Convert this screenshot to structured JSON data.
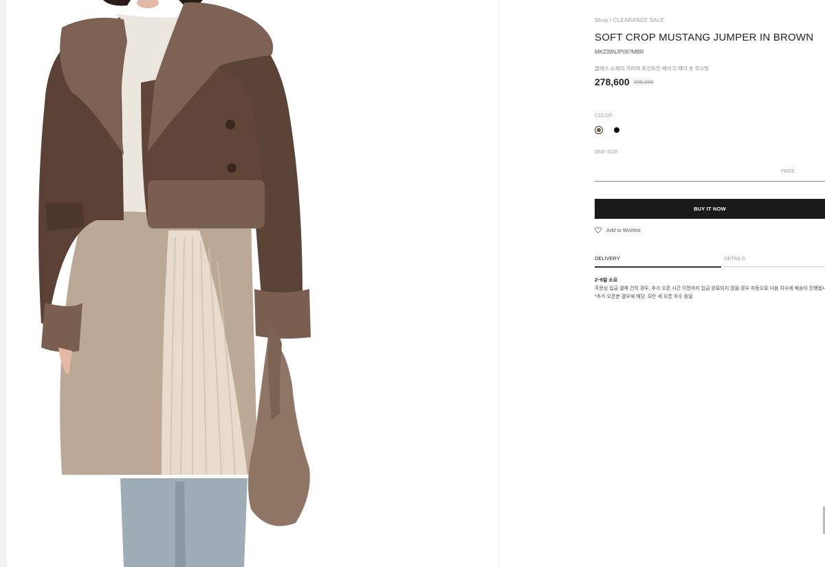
{
  "product": {
    "breadcrumb": "Shop / CLEARANCE SALE",
    "title": "SOFT CROP MUSTANG JUMPER IN BROWN",
    "code": "MK239NJP06?MBR",
    "description": "클래스 소재의 가려져 포인트인 베이크 레더 숏 무스탕",
    "price": "278,600",
    "original_price": "398,000"
  },
  "color": {
    "label": "COLOR",
    "options": [
      {
        "name": "brown",
        "hex": "#6b5a3a",
        "selected": true
      },
      {
        "name": "black",
        "hex": "#000000",
        "selected": false
      }
    ]
  },
  "size": {
    "label": "ONE SIZE",
    "value": "FREE"
  },
  "actions": {
    "buy_label": "BUY IT NOW",
    "wishlist_label": "Add to Wishlist"
  },
  "tabs": {
    "delivery": "DELIVERY",
    "details": "DETAILS"
  },
  "delivery": {
    "lead": "2~6일 소요",
    "line1": "주문상 입금 결제 건의 경우, 추가 오픈 시간 이전까지 입금 완료되지 않을 경우 자동으로 다음 차수에 배송이 진행됩니다.",
    "line2": "*추가 오픈분 결우에 해당, 모든 세 오픈 차수 동일"
  },
  "colors": {
    "buy_button_bg": "#1a1a1a",
    "accent_text": "#222222",
    "muted_text": "#9a9a9a"
  }
}
